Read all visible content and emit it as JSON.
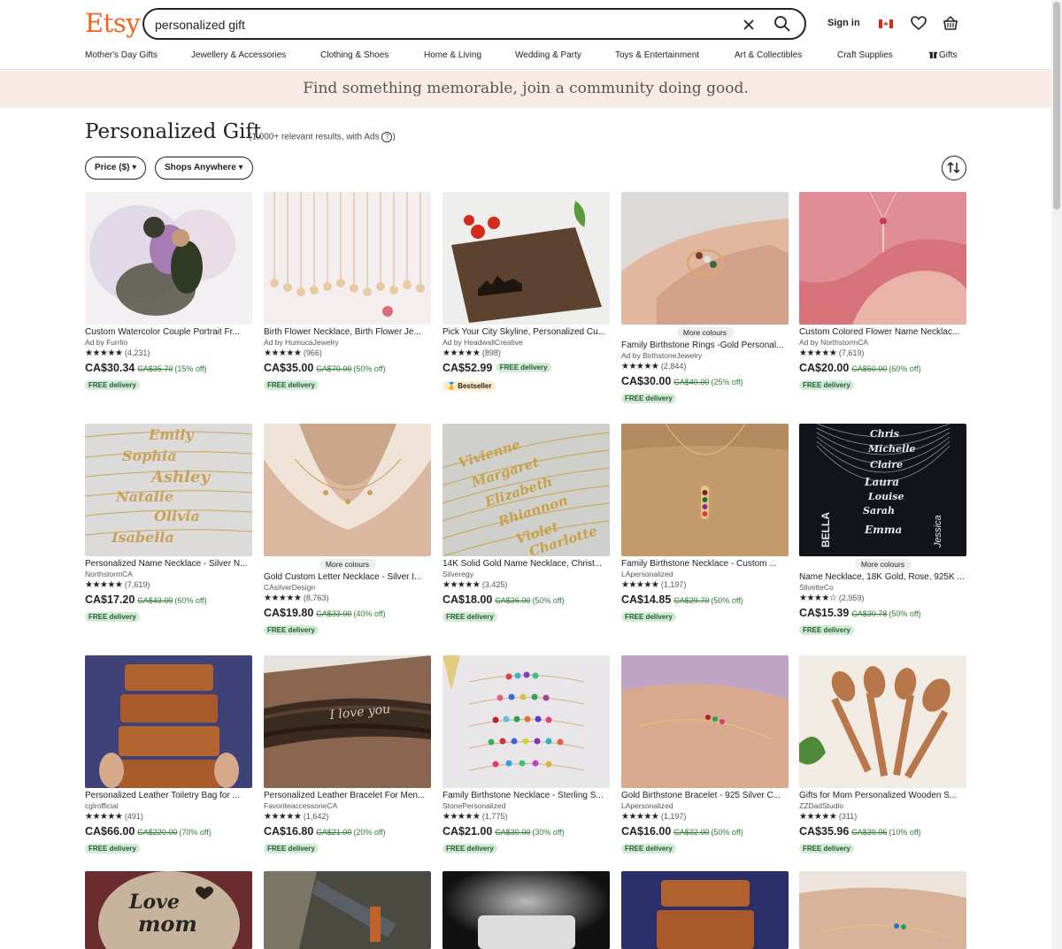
{
  "header": {
    "logo": "Etsy",
    "search_value": "personalized gift",
    "signin": "Sign in"
  },
  "nav": [
    "Mother's Day Gifts",
    "Jewellery & Accessories",
    "Clothing & Shoes",
    "Home & Living",
    "Wedding & Party",
    "Toys & Entertainment",
    "Art & Collectibles",
    "Craft Supplies",
    "Gifts"
  ],
  "banner": "Find something memorable, join a community doing good.",
  "page": {
    "title": "Personalized Gift",
    "results": "(1,000+ relevant results, with Ads",
    "results_close": ")",
    "help": "?"
  },
  "filters": {
    "price": "Price ($) ▾",
    "shops": "Shops Anywhere ▾"
  },
  "colors": {
    "brand": "#f1641e",
    "banner": "#f8ebe6",
    "discount": "#2e7d32",
    "free_bg": "#d4e9d7"
  },
  "products": [
    {
      "title": "Custom Watercolor Couple Portrait Fr...",
      "shop": "Ad by Furrlio",
      "stars": "★★★★★",
      "reviews": "(4,231)",
      "price": "CA$30.34",
      "orig": "CA$35.70",
      "disc": "(15% off)",
      "free": "FREE delivery",
      "more": "",
      "best": ""
    },
    {
      "title": "Birth Flower Necklace, Birth Flower Je...",
      "shop": "Ad by HumucaJewelry",
      "stars": "★★★★★",
      "reviews": "(966)",
      "price": "CA$35.00",
      "orig": "CA$70.00",
      "disc": "(50% off)",
      "free": "FREE delivery",
      "more": "",
      "best": ""
    },
    {
      "title": "Pick Your City Skyline, Personalized Cu...",
      "shop": "Ad by HeadwallCreative",
      "stars": "★★★★★",
      "reviews": "(898)",
      "price": "CA$52.99",
      "orig": "",
      "disc": "",
      "free": "FREE delivery",
      "more": "",
      "best": "Bestseller"
    },
    {
      "title": "Family Birthstone Rings -Gold Personal...",
      "shop": "Ad by BirthstoneJewelry",
      "stars": "★★★★★",
      "reviews": "(2,844)",
      "price": "CA$30.00",
      "orig": "CA$40.00",
      "disc": "(25% off)",
      "free": "FREE delivery",
      "more": "More colours",
      "best": ""
    },
    {
      "title": "Custom Colored Flower Name Necklac...",
      "shop": "Ad by NorthstormCA",
      "stars": "★★★★★",
      "reviews": "(7,619)",
      "price": "CA$20.00",
      "orig": "CA$50.00",
      "disc": "(60% off)",
      "free": "FREE delivery",
      "more": "",
      "best": ""
    },
    {
      "title": "Personalized Name Necklace - Silver N...",
      "shop": "NorthstormCA",
      "stars": "★★★★★",
      "reviews": "(7,619)",
      "price": "CA$17.20",
      "orig": "CA$43.00",
      "disc": "(60% off)",
      "free": "FREE delivery",
      "more": "",
      "best": ""
    },
    {
      "title": "Gold Custom Letter Necklace - Silver I...",
      "shop": "CAsilverDesign",
      "stars": "★★★★★",
      "reviews": "(8,763)",
      "price": "CA$19.80",
      "orig": "CA$33.00",
      "disc": "(40% off)",
      "free": "FREE delivery",
      "more": "More colours",
      "best": ""
    },
    {
      "title": "14K Solid Gold Name Necklace, Christ...",
      "shop": "Silveregy",
      "stars": "★★★★★",
      "reviews": "(3,425)",
      "price": "CA$18.00",
      "orig": "CA$36.00",
      "disc": "(50% off)",
      "free": "FREE delivery",
      "more": "",
      "best": ""
    },
    {
      "title": "Family Birthstone Necklace - Custom ...",
      "shop": "LApersonalized",
      "stars": "★★★★★",
      "reviews": "(1,197)",
      "price": "CA$14.85",
      "orig": "CA$29.70",
      "disc": "(50% off)",
      "free": "FREE delivery",
      "more": "",
      "best": ""
    },
    {
      "title": "Name Necklace, 18K Gold, Rose, 925K ...",
      "shop": "SilvetteCo",
      "stars": "★★★★☆",
      "reviews": "(2,959)",
      "price": "CA$15.39",
      "orig": "CA$30.78",
      "disc": "(50% off)",
      "free": "FREE delivery",
      "more": "More colours",
      "best": ""
    },
    {
      "title": "Personalized Leather Toiletry Bag for ...",
      "shop": "cglrofficial",
      "stars": "★★★★★",
      "reviews": "(491)",
      "price": "CA$66.00",
      "orig": "CA$220.00",
      "disc": "(70% off)",
      "free": "FREE delivery",
      "more": "",
      "best": ""
    },
    {
      "title": "Personalized Leather Bracelet For Men...",
      "shop": "FavoriteaccessorieCA",
      "stars": "★★★★★",
      "reviews": "(1,642)",
      "price": "CA$16.80",
      "orig": "CA$21.00",
      "disc": "(20% off)",
      "free": "FREE delivery",
      "more": "",
      "best": ""
    },
    {
      "title": "Family Birthstone Necklace - Sterling S...",
      "shop": "StonePersonalized",
      "stars": "★★★★★",
      "reviews": "(1,775)",
      "price": "CA$21.00",
      "orig": "CA$30.00",
      "disc": "(30% off)",
      "free": "FREE delivery",
      "more": "",
      "best": ""
    },
    {
      "title": "Gold Birthstone Bracelet - 925 Silver C...",
      "shop": "LApersonalized",
      "stars": "★★★★★",
      "reviews": "(1,197)",
      "price": "CA$16.00",
      "orig": "CA$32.00",
      "disc": "(50% off)",
      "free": "FREE delivery",
      "more": "",
      "best": ""
    },
    {
      "title": "Gifts for Mom Personalized Wooden S...",
      "shop": "ZZDadStudio",
      "stars": "★★★★★",
      "reviews": "(311)",
      "price": "CA$35.96",
      "orig": "CA$39.96",
      "disc": "(10% off)",
      "free": "FREE delivery",
      "more": "",
      "best": ""
    }
  ]
}
